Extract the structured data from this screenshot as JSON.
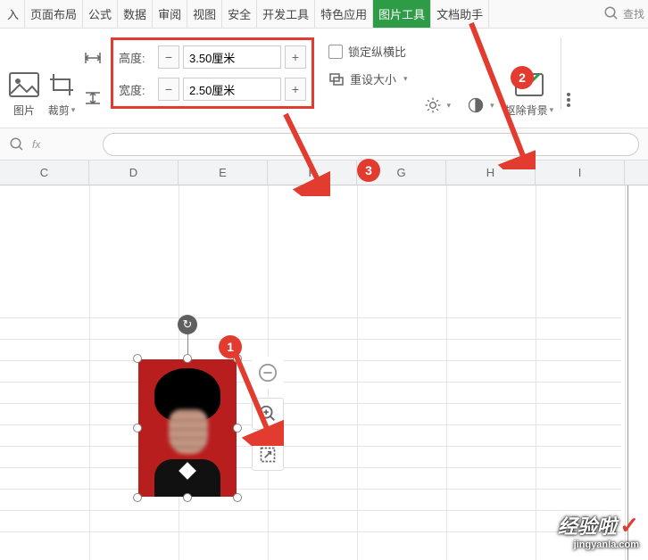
{
  "tabs": {
    "items": [
      "入",
      "页面布局",
      "公式",
      "数据",
      "审阅",
      "视图",
      "安全",
      "开发工具",
      "特色应用",
      "图片工具",
      "文档助手"
    ],
    "active_index": 9
  },
  "search": {
    "placeholder": "查找"
  },
  "ribbon": {
    "picture_label": "图片",
    "crop_label": "裁剪",
    "size": {
      "height_label": "高度:",
      "height_value": "3.50厘米",
      "width_label": "宽度:",
      "width_value": "2.50厘米",
      "minus": "−",
      "plus": "+"
    },
    "lock_aspect": "锁定纵横比",
    "reset_size": "重设大小",
    "remove_bg": "抠除背景"
  },
  "formula_bar": {
    "fx": "fx"
  },
  "columns": [
    "C",
    "D",
    "E",
    "F",
    "G",
    "H",
    "I"
  ],
  "annotations": {
    "badge1": "1",
    "badge2": "2",
    "badge3": "3"
  },
  "watermark": {
    "title": "经验啦",
    "check": "✓",
    "url": "jingyanla.com"
  }
}
